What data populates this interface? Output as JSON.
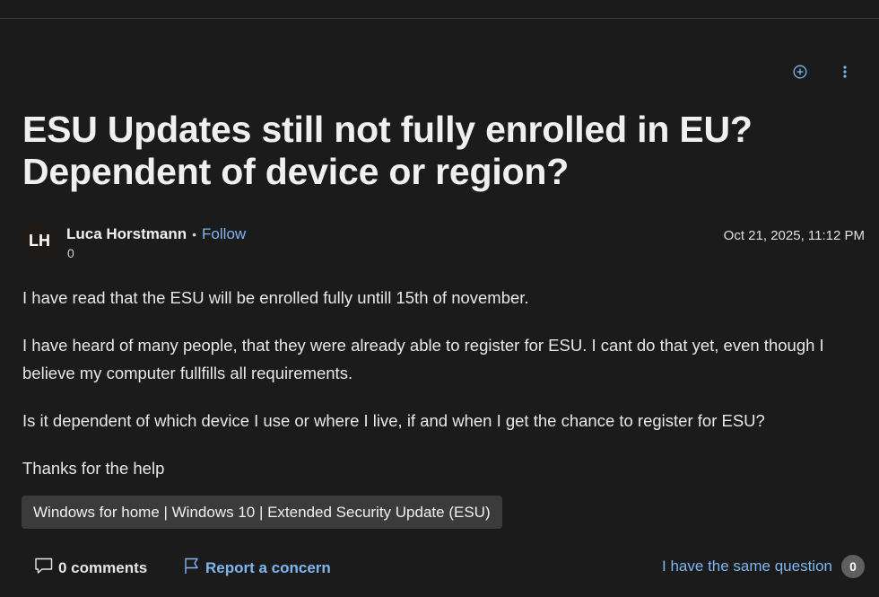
{
  "question": {
    "title": "ESU Updates still not fully enrolled in EU? Dependent of device or region?",
    "author": {
      "initials": "LH",
      "name": "Luca Horstmann",
      "separator": "•",
      "follow_label": "Follow",
      "reputation": "0"
    },
    "date": "Oct 21, 2025, 11:12 PM",
    "body": [
      "I have read that the ESU will be enrolled fully untill 15th of november.",
      "I have heard of many people, that they were already able to register for ESU. I cant do that yet, even though I believe my computer fullfills all requirements.",
      "Is it dependent of which device I use or where I live, if and when I get the chance to register for ESU?",
      "Thanks for the help"
    ],
    "tag": "Windows for home | Windows 10 | Extended Security Update (ESU)"
  },
  "footer": {
    "comments_label": "0 comments",
    "report_label": "Report a concern",
    "same_question_label": "I have the same question",
    "same_question_count": "0"
  },
  "icons": {
    "add": "add-circle-icon",
    "more": "more-vertical-icon",
    "comment": "comment-icon",
    "flag": "flag-icon"
  },
  "colors": {
    "background": "#1b1b1b",
    "text": "#e6e6e6",
    "link": "#7eb6f0",
    "tag_bg": "#3b3b3b",
    "badge_bg": "#5f5f5f"
  }
}
